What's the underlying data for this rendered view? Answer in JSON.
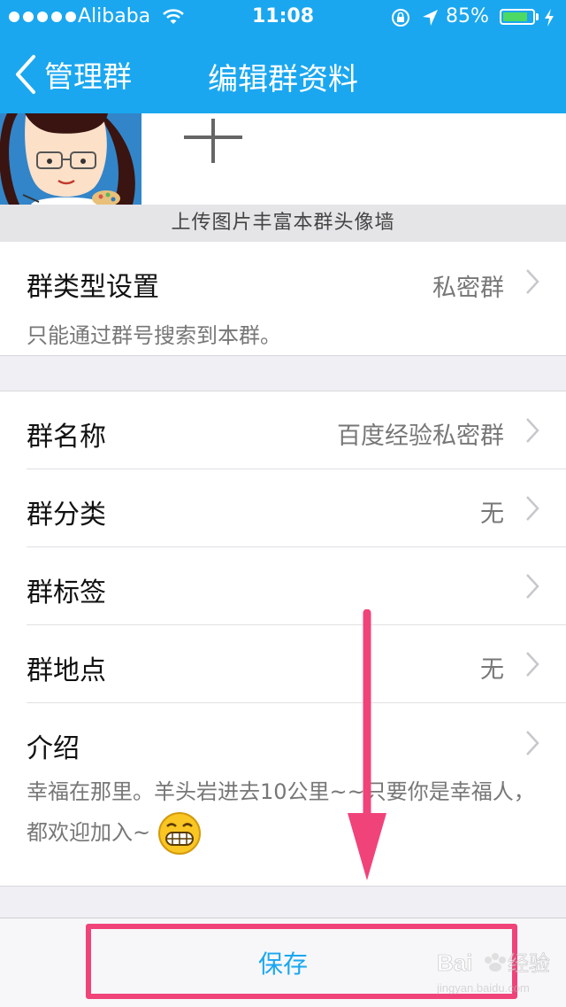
{
  "status_bar": {
    "carrier": "Alibaba",
    "time": "11:08",
    "battery": "85%",
    "battery_level": 0.85
  },
  "nav": {
    "back_label": "管理群",
    "title": "编辑群资料"
  },
  "photos": {
    "upload_tip": "上传图片丰富本群头像墙"
  },
  "group_type": {
    "label": "群类型设置",
    "value": "私密群",
    "description": "只能通过群号搜索到本群。"
  },
  "info_rows": [
    {
      "label": "群名称",
      "value": "百度经验私密群"
    },
    {
      "label": "群分类",
      "value": "无"
    },
    {
      "label": "群标签",
      "value": ""
    },
    {
      "label": "群地点",
      "value": "无"
    }
  ],
  "intro": {
    "label": "介绍",
    "text": "幸福在那里。羊头岩进去10公里~~只要你是幸福人，都欢迎加入~"
  },
  "footer": {
    "save_label": "保存"
  },
  "colors": {
    "brand": "#1aa7f0",
    "annotation": "#f0437a",
    "battery": "#4cd964"
  }
}
